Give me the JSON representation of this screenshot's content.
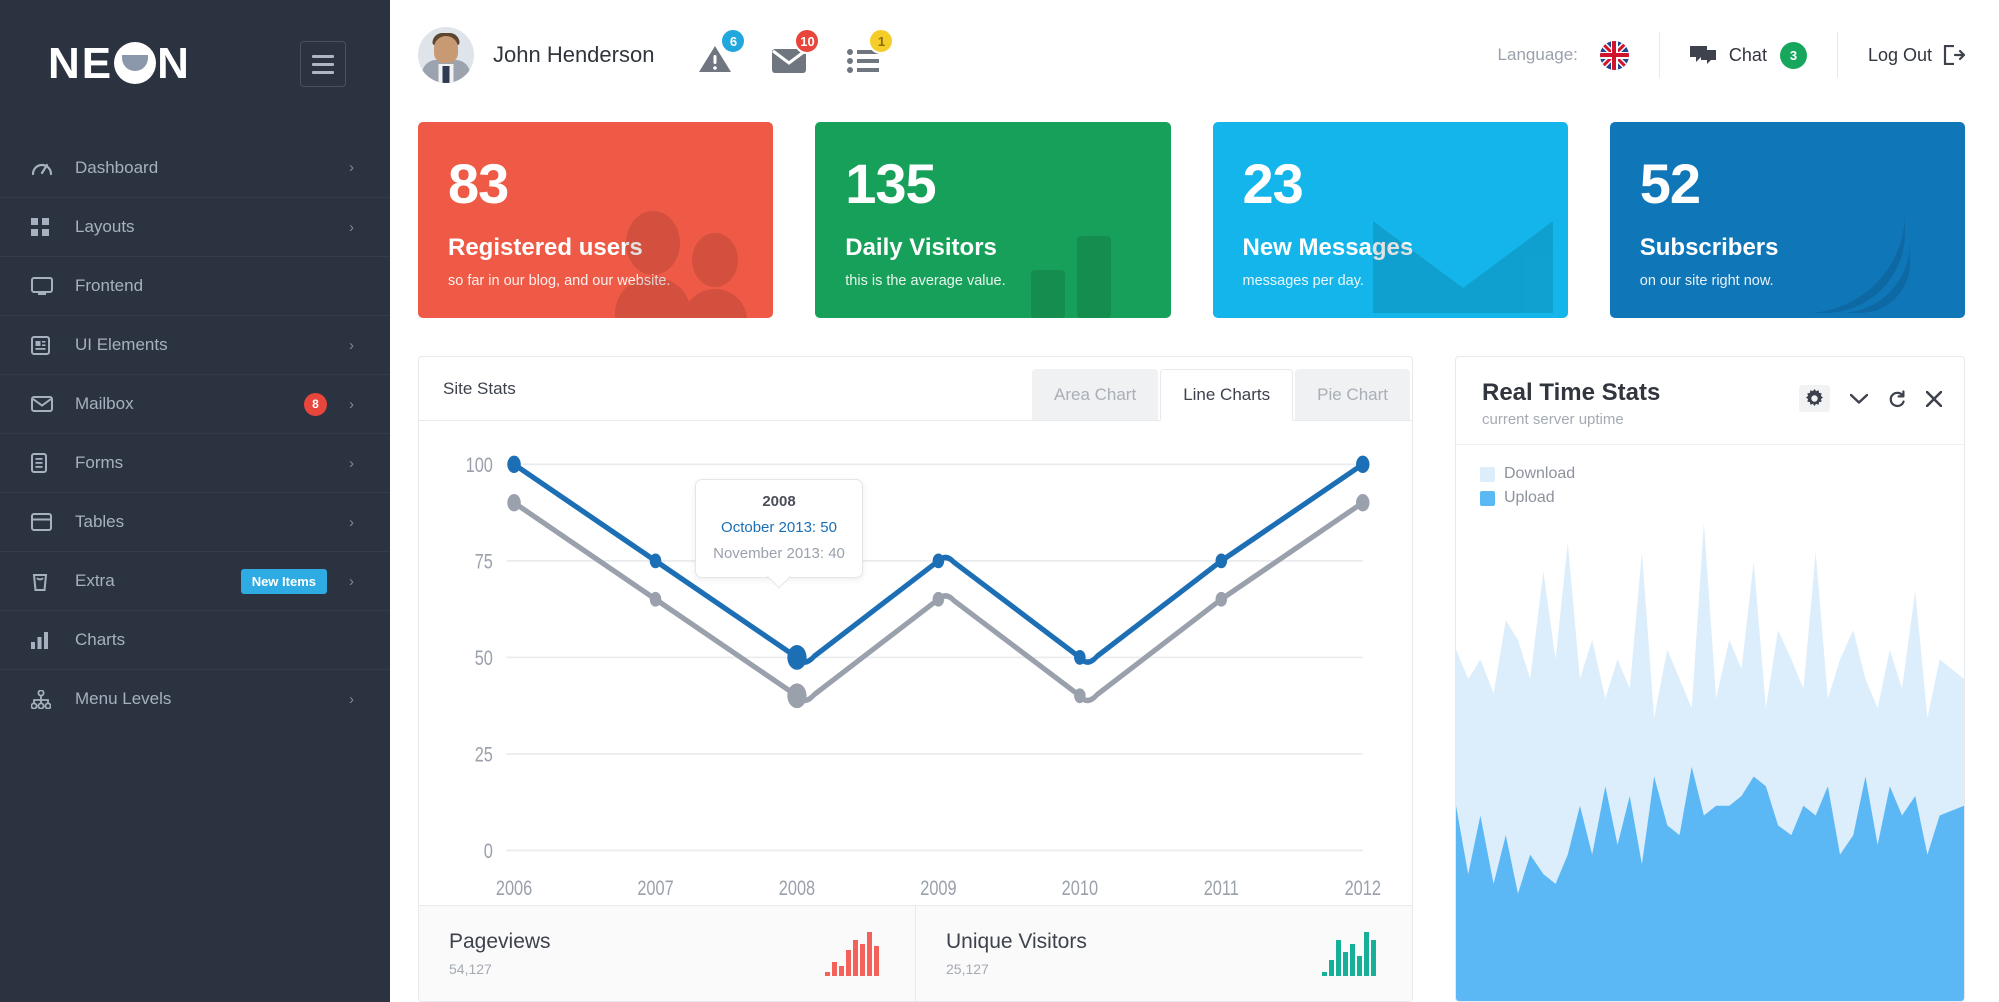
{
  "sidebar": {
    "logo": "NEON",
    "menu_toggle_icon": "hamburger-icon",
    "items": [
      {
        "label": "Dashboard",
        "icon": "speedometer-icon",
        "caret": "›",
        "badge": null,
        "pill": null
      },
      {
        "label": "Layouts",
        "icon": "grid-icon",
        "caret": "›",
        "badge": null,
        "pill": null
      },
      {
        "label": "Frontend",
        "icon": "monitor-icon",
        "caret": "",
        "badge": null,
        "pill": null
      },
      {
        "label": "UI Elements",
        "icon": "ui-card-icon",
        "caret": "›",
        "badge": null,
        "pill": null
      },
      {
        "label": "Mailbox",
        "icon": "envelope-icon",
        "caret": "›",
        "badge": "8",
        "pill": null
      },
      {
        "label": "Forms",
        "icon": "form-icon",
        "caret": "›",
        "badge": null,
        "pill": null
      },
      {
        "label": "Tables",
        "icon": "table-icon",
        "caret": "›",
        "badge": null,
        "pill": null
      },
      {
        "label": "Extra",
        "icon": "trash-icon",
        "caret": "›",
        "badge": null,
        "pill": "New Items"
      },
      {
        "label": "Charts",
        "icon": "bar-chart-icon",
        "caret": "",
        "badge": null,
        "pill": null
      },
      {
        "label": "Menu Levels",
        "icon": "sitemap-icon",
        "caret": "›",
        "badge": null,
        "pill": null
      }
    ]
  },
  "topbar": {
    "user_name": "John Henderson",
    "avatar_icon": "user-avatar",
    "notifications": [
      {
        "icon": "warning-triangle-icon",
        "count": "6",
        "badge_color": "#22a7dd"
      },
      {
        "icon": "envelope-icon",
        "count": "10",
        "badge_color": "#e8453c"
      },
      {
        "icon": "task-list-icon",
        "count": "1",
        "badge_color": "#f5cd2a"
      }
    ],
    "language_label": "Language:",
    "language_flag_icon": "uk-flag-icon",
    "chat_label": "Chat",
    "chat_icon": "chat-bubbles-icon",
    "chat_count": "3",
    "logout_label": "Log Out",
    "logout_icon": "logout-arrow-icon"
  },
  "cards": [
    {
      "number": "83",
      "label": "Registered users",
      "sub": "so far in our blog, and our website.",
      "color": "#ef5a46",
      "watermark": "people-icon"
    },
    {
      "number": "135",
      "label": "Daily Visitors",
      "sub": "this is the average value.",
      "color": "#17a05a",
      "watermark": "bar-chart-icon"
    },
    {
      "number": "23",
      "label": "New Messages",
      "sub": "messages per day.",
      "color": "#13b5ea",
      "watermark": "envelope-icon"
    },
    {
      "number": "52",
      "label": "Subscribers",
      "sub": "on our site right now.",
      "color": "#0f76b8",
      "watermark": "rss-icon"
    }
  ],
  "site_stats": {
    "title": "Site Stats",
    "tabs": [
      {
        "label": "Area Chart",
        "active": false
      },
      {
        "label": "Line Charts",
        "active": true
      },
      {
        "label": "Pie Chart",
        "active": false
      }
    ],
    "tooltip": {
      "title": "2008",
      "row1": "October 2013: 50",
      "row2": "November 2013: 40"
    },
    "footer": [
      {
        "name": "Pageviews",
        "value": "54,127",
        "spark_color": "#f4615a"
      },
      {
        "name": "Unique Visitors",
        "value": "25,127",
        "spark_color": "#15b097"
      }
    ]
  },
  "real_time": {
    "title": "Real Time Stats",
    "subtitle": "current server uptime",
    "actions": [
      {
        "icon": "gear-icon",
        "glyph": "⚙"
      },
      {
        "icon": "chevron-down-icon",
        "glyph": "˅"
      },
      {
        "icon": "refresh-icon",
        "glyph": "↻"
      },
      {
        "icon": "close-icon",
        "glyph": "✕"
      }
    ],
    "legend": [
      {
        "label": "Download",
        "color": "#dceefb"
      },
      {
        "label": "Upload",
        "color": "#5cb8f5"
      }
    ]
  },
  "chart_data": [
    {
      "type": "line",
      "title": "Site Stats",
      "x": [
        "2006",
        "2007",
        "2008",
        "2009",
        "2010",
        "2011",
        "2012"
      ],
      "series": [
        {
          "name": "October 2013",
          "color": "#1c6fb5",
          "values": [
            100,
            75,
            50,
            75,
            50,
            75,
            100
          ]
        },
        {
          "name": "November 2013",
          "color": "#9aa1ac",
          "values": [
            90,
            65,
            40,
            65,
            40,
            65,
            90
          ]
        }
      ],
      "ylim": [
        0,
        100
      ],
      "yticks": [
        0,
        25,
        50,
        75,
        100
      ],
      "xlabel": "",
      "ylabel": "",
      "grid": true,
      "legend_position": "none",
      "highlight_index": 2
    },
    {
      "type": "area",
      "title": "Real Time Stats",
      "series": [
        {
          "name": "Download",
          "color": "#dceefb",
          "values": [
            72,
            66,
            70,
            63,
            78,
            74,
            66,
            84,
            70,
            88,
            66,
            74,
            62,
            70,
            64,
            88,
            58,
            72,
            66,
            60,
            94,
            62,
            74,
            68,
            86,
            60,
            76,
            70,
            64,
            88,
            62,
            70,
            76,
            66,
            60,
            72,
            64,
            80,
            58,
            70,
            66
          ]
        },
        {
          "name": "Upload",
          "color": "#5cb8f5",
          "values": [
            40,
            26,
            38,
            24,
            34,
            22,
            30,
            26,
            24,
            30,
            40,
            30,
            44,
            32,
            42,
            28,
            46,
            36,
            34,
            48,
            38,
            40,
            40,
            42,
            46,
            44,
            36,
            34,
            40,
            38,
            44,
            30,
            34,
            46,
            32,
            44,
            38,
            42,
            30,
            38,
            40
          ]
        }
      ],
      "ylim": [
        0,
        100
      ],
      "grid": false,
      "legend_position": "top-left"
    },
    {
      "type": "bar",
      "title": "Pageviews",
      "values": [
        4,
        14,
        10,
        26,
        36,
        52,
        74,
        44
      ],
      "color": "#f4615a",
      "grid": false
    },
    {
      "type": "bar",
      "title": "Unique Visitors",
      "values": [
        4,
        30,
        66,
        44,
        58,
        38,
        74,
        66
      ],
      "color": "#15b097",
      "grid": false
    }
  ]
}
